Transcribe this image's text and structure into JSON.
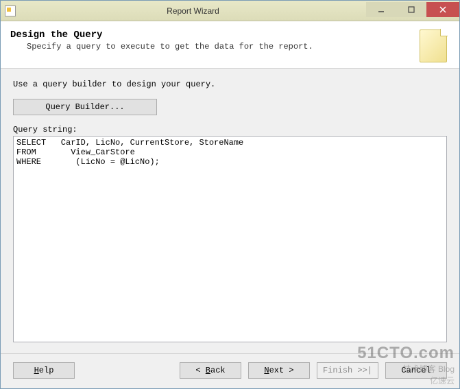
{
  "window": {
    "title": "Report Wizard"
  },
  "header": {
    "title": "Design the Query",
    "subtitle": "Specify a query to execute to get the data for the report."
  },
  "content": {
    "instruction": "Use a query builder to design your query.",
    "queryBuilderLabel": "Query Builder...",
    "queryStringLabel": "Query string:",
    "queryStringValue": "SELECT   CarID, LicNo, CurrentStore, StoreName\nFROM       View_CarStore\nWHERE       (LicNo = @LicNo);"
  },
  "buttons": {
    "help": "Help",
    "back": "< Back",
    "next": "Next >",
    "finish": "Finish >>|",
    "cancel": "Cancel"
  },
  "watermark": {
    "line1": "51CTO.com",
    "line2": "技术博客 Blog",
    "line3": "亿速云"
  }
}
